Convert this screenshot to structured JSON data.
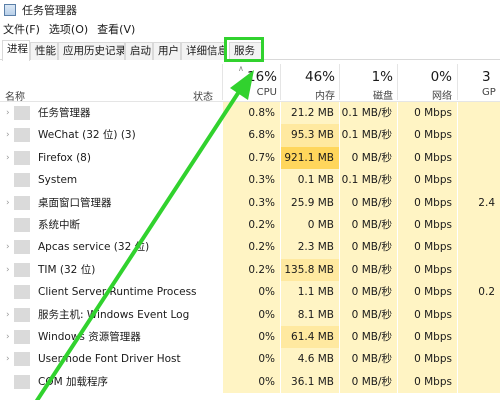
{
  "app": {
    "title": "任务管理器",
    "icon": "task-manager-icon"
  },
  "menu": [
    "文件(F)",
    "选项(O)",
    "查看(V)"
  ],
  "tabs": [
    "进程",
    "性能",
    "应用历史记录",
    "启动",
    "用户",
    "详细信息",
    "服务"
  ],
  "header": {
    "name": "名称",
    "status": "状态",
    "cpu": {
      "pct": "16%",
      "label": "CPU"
    },
    "memory": {
      "pct": "46%",
      "label": "内存"
    },
    "disk": {
      "pct": "1%",
      "label": "磁盘"
    },
    "network": {
      "pct": "0%",
      "label": "网络"
    },
    "gpu": {
      "pct": "3",
      "label": "GP"
    }
  },
  "processes": [
    {
      "name": "任务管理器",
      "cpu": "0.8%",
      "mem": "21.2 MB",
      "disk": "0.1 MB/秒",
      "net": "0 Mbps",
      "gpu": ""
    },
    {
      "name": "WeChat (32 位) (3)",
      "cpu": "6.8%",
      "mem": "95.3 MB",
      "disk": "0.1 MB/秒",
      "net": "0 Mbps",
      "gpu": ""
    },
    {
      "name": "Firefox (8)",
      "cpu": "0.7%",
      "mem": "921.1 MB",
      "disk": "0 MB/秒",
      "net": "0 Mbps",
      "gpu": ""
    },
    {
      "name": "System",
      "cpu": "0.3%",
      "mem": "0.1 MB",
      "disk": "0.1 MB/秒",
      "net": "0 Mbps",
      "gpu": ""
    },
    {
      "name": "桌面窗口管理器",
      "cpu": "0.3%",
      "mem": "25.9 MB",
      "disk": "0 MB/秒",
      "net": "0 Mbps",
      "gpu": "2.4"
    },
    {
      "name": "系统中断",
      "cpu": "0.2%",
      "mem": "0 MB",
      "disk": "0 MB/秒",
      "net": "0 Mbps",
      "gpu": ""
    },
    {
      "name": "Apcas service (32 位)",
      "cpu": "0.2%",
      "mem": "2.3 MB",
      "disk": "0 MB/秒",
      "net": "0 Mbps",
      "gpu": ""
    },
    {
      "name": "TIM (32 位)",
      "cpu": "0.2%",
      "mem": "135.8 MB",
      "disk": "0 MB/秒",
      "net": "0 Mbps",
      "gpu": ""
    },
    {
      "name": "Client Server Runtime Process",
      "cpu": "0%",
      "mem": "1.1 MB",
      "disk": "0 MB/秒",
      "net": "0 Mbps",
      "gpu": "0.2"
    },
    {
      "name": "服务主机: Windows Event Log",
      "cpu": "0%",
      "mem": "8.1 MB",
      "disk": "0 MB/秒",
      "net": "0 Mbps",
      "gpu": ""
    },
    {
      "name": "Windows 资源管理器",
      "cpu": "0%",
      "mem": "61.4 MB",
      "disk": "0 MB/秒",
      "net": "0 Mbps",
      "gpu": ""
    },
    {
      "name": "Usermode Font Driver Host",
      "cpu": "0%",
      "mem": "4.6 MB",
      "disk": "0 MB/秒",
      "net": "0 Mbps",
      "gpu": ""
    },
    {
      "name": "COM 加载程序",
      "cpu": "0%",
      "mem": "36.1 MB",
      "disk": "0 MB/秒",
      "net": "0 Mbps",
      "gpu": ""
    }
  ],
  "colors": {
    "cpu_bg": "#fff4c4",
    "mem_bg": "#fff4c4",
    "mem_hot_bg": "#ffd65c",
    "mem_warm_bg": "#ffe9a0",
    "annotation_green": "#31d22e"
  }
}
